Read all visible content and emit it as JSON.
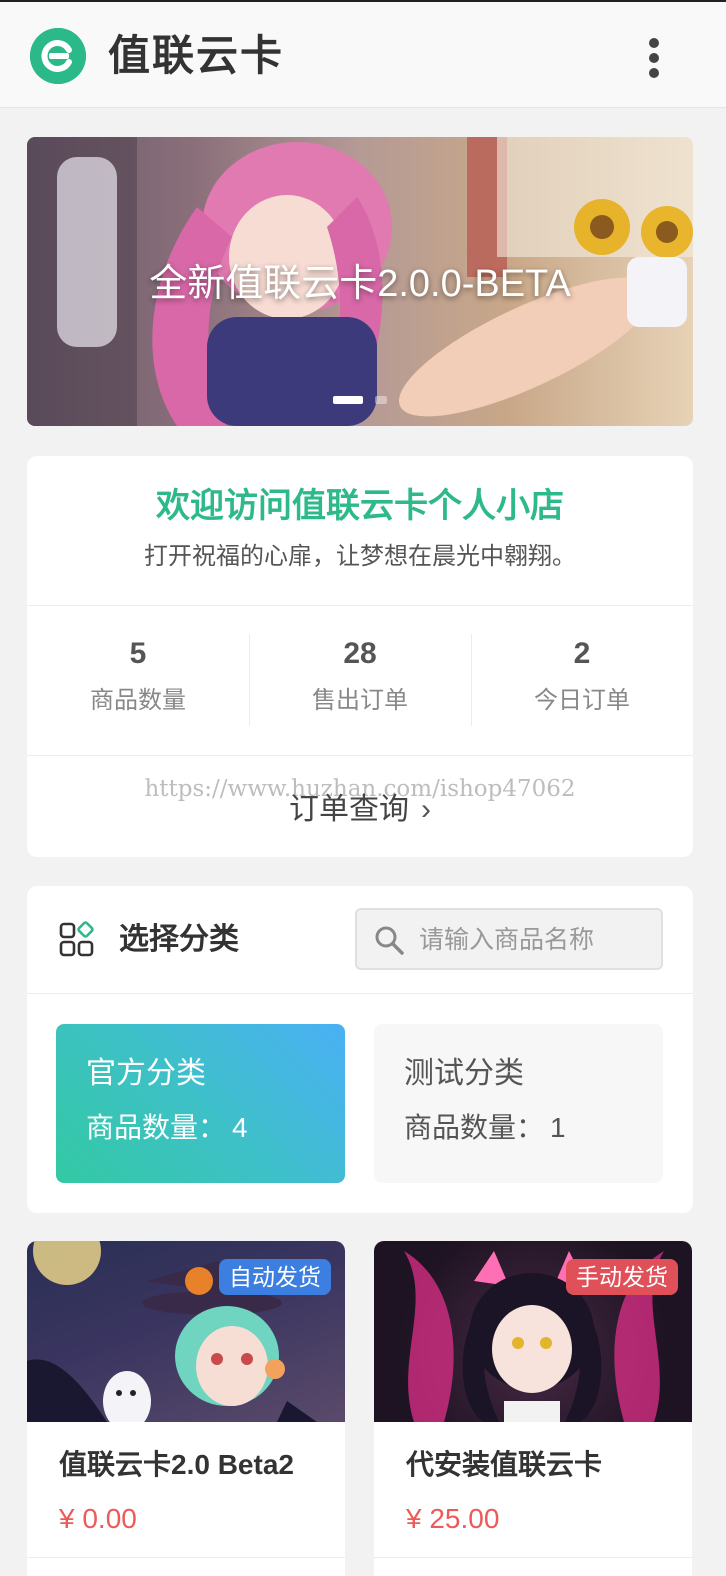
{
  "header": {
    "title": "值联云卡",
    "logo_icon": "brand-e-logo-icon",
    "menu_icon": "more-vertical-icon"
  },
  "banner": {
    "caption": "全新值联云卡2.0.0-BETA",
    "slide_count": 2,
    "active_slide": 1
  },
  "welcome": {
    "title": "欢迎访问值联云卡个人小店",
    "subtitle": "打开祝福的心扉，让梦想在晨光中翱翔。",
    "stats": [
      {
        "value": "5",
        "label": "商品数量"
      },
      {
        "value": "28",
        "label": "售出订单"
      },
      {
        "value": "2",
        "label": "今日订单"
      }
    ],
    "watermark": "https://www.huzhan.com/ishop47062",
    "order_query": "订单查询"
  },
  "category": {
    "title": "选择分类",
    "search_placeholder": "请输入商品名称",
    "items": [
      {
        "name": "官方分类",
        "count_label": "商品数量：",
        "count": "4",
        "active": true
      },
      {
        "name": "测试分类",
        "count_label": "商品数量：",
        "count": "1",
        "active": false
      }
    ]
  },
  "products": [
    {
      "name": "值联云卡2.0 Beta2",
      "price": "¥ 0.00",
      "badge": "自动发货"
    },
    {
      "name": "代安装值联云卡",
      "price": "¥ 25.00",
      "badge": "手动发货"
    }
  ],
  "colors": {
    "accent": "#2eb98a",
    "price": "#ec5a5a",
    "badge_auto": "#3d7fe0",
    "badge_manual": "#e05058"
  }
}
